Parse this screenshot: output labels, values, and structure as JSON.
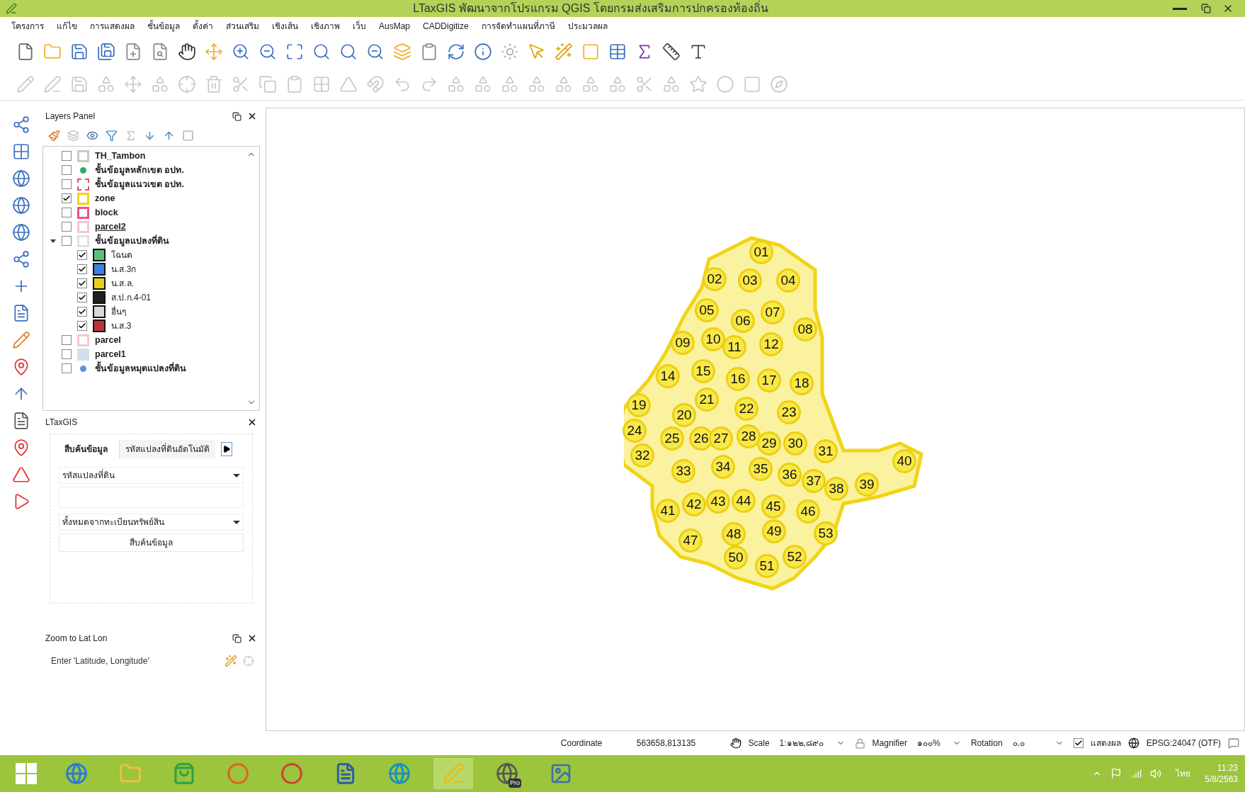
{
  "window": {
    "title": "LTaxGIS พัฒนาจากโปรแกรม QGIS โดยกรมส่งเสริมการปกครองท้องถิ่น"
  },
  "menu": [
    "โครงการ",
    "แก้ไข",
    "การแสดงผล",
    "ชั้นข้อมูล",
    "ตั้งค่า",
    "ส่วนเสริม",
    "เชิงเส้น",
    "เชิงภาพ",
    "เว็บ",
    "AusMap",
    "CADDigitize",
    "การจัดทำแผนที่ภาษี",
    "ประมวลผล"
  ],
  "layers_panel": {
    "title": "Layers Panel",
    "layers": [
      {
        "name": "TH_Tambon",
        "checked": false,
        "kind": "outline",
        "color": "#c8c8c8",
        "underlined": false
      },
      {
        "name": "ชั้นข้อมูลหลักเขต อปท.",
        "checked": false,
        "kind": "dot",
        "color": "#2eaa6a",
        "underlined": false
      },
      {
        "name": "ชั้นข้อมูลแนวเขต อปท.",
        "checked": false,
        "kind": "dashed",
        "color": "#e0506a",
        "underlined": false
      },
      {
        "name": "zone",
        "checked": true,
        "kind": "outline",
        "color": "#f5d020",
        "underlined": false
      },
      {
        "name": "block",
        "checked": false,
        "kind": "outline",
        "color": "#f0508a",
        "underlined": false
      },
      {
        "name": "parcel2",
        "checked": false,
        "kind": "outline",
        "color": "#f6c6cc",
        "underlined": true
      },
      {
        "name": "ชั้นข้อมูลแปลงที่ดิน",
        "checked": false,
        "kind": "outline",
        "color": "#e0e0e0",
        "underlined": false,
        "expanded": true,
        "children": [
          {
            "name": "โฉนด",
            "checked": true,
            "color": "#5cbf7a"
          },
          {
            "name": "น.ส.3ก",
            "checked": true,
            "color": "#3d7fe0"
          },
          {
            "name": "น.ส.ล.",
            "checked": true,
            "color": "#e8d020"
          },
          {
            "name": "ส.ป.ก.4-01",
            "checked": true,
            "color": "#202020"
          },
          {
            "name": "อื่นๆ",
            "checked": true,
            "color": "#d8d8d8"
          },
          {
            "name": "น.ส.3",
            "checked": true,
            "color": "#c0303a"
          }
        ]
      },
      {
        "name": "parcel",
        "checked": false,
        "kind": "outline",
        "color": "#f6c6cc",
        "underlined": false
      },
      {
        "name": "parcel1",
        "checked": false,
        "kind": "fill",
        "color": "#cfe0f0",
        "underlined": false
      },
      {
        "name": "ชั้นข้อมูลหมุดแปลงที่ดิน",
        "checked": false,
        "kind": "dot",
        "color": "#5b8fe0",
        "underlined": false
      }
    ]
  },
  "ltaxgis_panel": {
    "title": "LTaxGIS",
    "tabs": [
      {
        "label": "สืบค้นข้อมูล",
        "selected": true
      },
      {
        "label": "รหัสแปลงที่ดินอัตโนมัติ",
        "selected": false
      }
    ],
    "select_1": "รหัสแปลงที่ดิน",
    "select_2": "ทั้งหมดจากทะเบียนทรัพย์สิน",
    "button": "สืบค้นข้อมูล"
  },
  "zoom_panel": {
    "title": "Zoom to Lat Lon",
    "placeholder": "Enter 'Latitude, Longitude'"
  },
  "map": {
    "parcels": [
      "01",
      "02",
      "03",
      "04",
      "05",
      "06",
      "07",
      "08",
      "09",
      "10",
      "11",
      "12",
      "14",
      "15",
      "16",
      "17",
      "18",
      "19",
      "20",
      "21",
      "22",
      "23",
      "24",
      "25",
      "26",
      "27",
      "28",
      "29",
      "30",
      "31",
      "32",
      "33",
      "34",
      "35",
      "36",
      "37",
      "38",
      "39",
      "40",
      "41",
      "42",
      "43",
      "44",
      "45",
      "46",
      "47",
      "48",
      "49",
      "50",
      "51",
      "52",
      "53"
    ]
  },
  "status_bar": {
    "coordinate_label": "Coordinate",
    "coordinate": "563658,813135",
    "scale_label": "Scale",
    "scale": "1:๑๒๒,๘๙๐",
    "magnifier_label": "Magnifier",
    "magnifier": "๑๐๐%",
    "rotation_label": "Rotation",
    "rotation": "๐.๐",
    "render": {
      "label": "แสดงผล",
      "checked": true
    },
    "crs": "EPSG:24047 (OTF)"
  },
  "taskbar": {
    "badge": "Pro",
    "language": "ไทย",
    "time": "11:23",
    "date": "5/8/2563"
  }
}
